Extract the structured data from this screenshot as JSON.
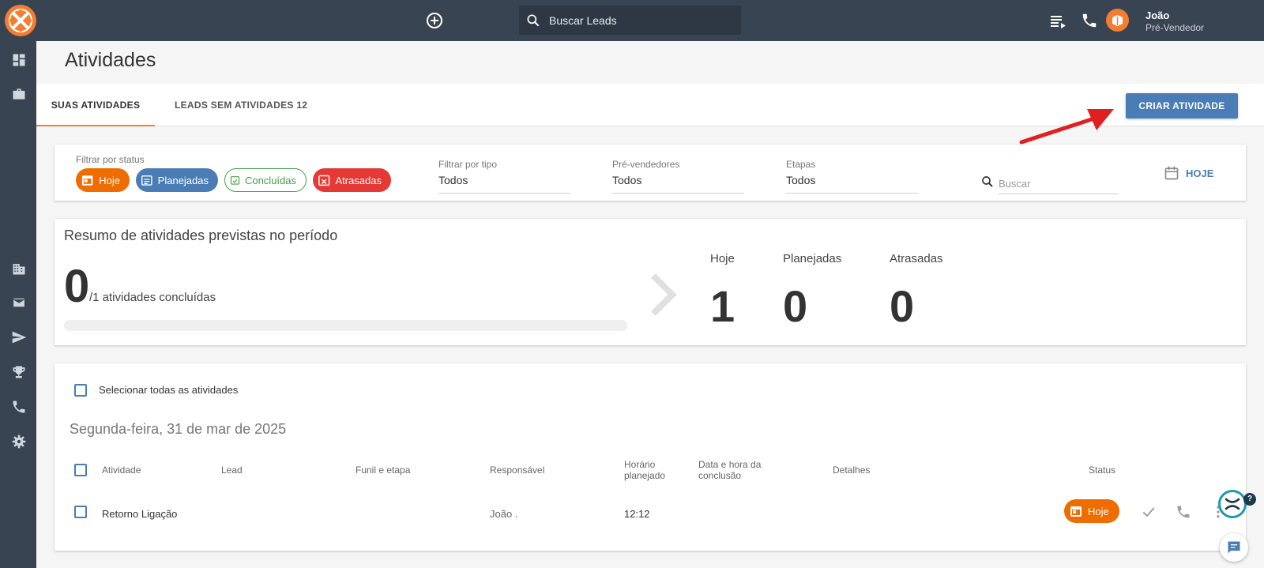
{
  "topbar": {
    "search_placeholder": "Buscar Leads",
    "user_name": "João",
    "user_role": "Pré-Vendedor"
  },
  "page": {
    "title": "Atividades"
  },
  "tabs": [
    {
      "label": "SUAS ATIVIDADES",
      "active": true
    },
    {
      "label": "LEADS SEM ATIVIDADES 12",
      "active": false
    }
  ],
  "actions": {
    "create_label": "CRIAR ATIVIDADE"
  },
  "filters": {
    "status_label": "Filtrar por status",
    "status_chips": [
      "Hoje",
      "Planejadas",
      "Concluídas",
      "Atrasadas"
    ],
    "type_label": "Filtrar por tipo",
    "type_value": "Todos",
    "presales_label": "Pré-vendedores",
    "presales_value": "Todos",
    "stages_label": "Etapas",
    "stages_value": "Todos",
    "search_placeholder": "Buscar",
    "date_button": "HOJE"
  },
  "summary": {
    "title": "Resumo de atividades previstas no período",
    "completed": "0",
    "completed_suffix": "/1 atividades concluídas",
    "progress": 0,
    "stats": [
      {
        "label": "Hoje",
        "value": "1"
      },
      {
        "label": "Planejadas",
        "value": "0"
      },
      {
        "label": "Atrasadas",
        "value": "0"
      }
    ]
  },
  "list": {
    "select_all_label": "Selecionar todas as atividades",
    "date_heading": "Segunda-feira, 31 de mar de 2025",
    "columns": {
      "activity": "Atividade",
      "lead": "Lead",
      "funnel": "Funil e etapa",
      "owner": "Responsável",
      "planned_time": "Horário planejado",
      "completed_at": "Data e hora da conclusão",
      "details": "Detalhes",
      "status": "Status"
    },
    "rows": [
      {
        "activity": "Retorno Ligação",
        "lead": "",
        "funnel": "",
        "owner": "João .",
        "planned_time": "12:12",
        "completed_at": "",
        "details": "",
        "status": "Hoje"
      }
    ]
  },
  "colors": {
    "topbar": "#384452",
    "accent_orange": "#f47d30",
    "primary_blue": "#4a7cb5",
    "today_orange": "#ef6c00",
    "done_green": "#43a047",
    "late_red": "#e53935",
    "annotation_arrow": "#e02020"
  },
  "icons": {
    "sidebar": [
      "dashboard-icon",
      "briefcase-icon",
      "building-icon",
      "mail-icon",
      "send-icon",
      "trophy-icon",
      "phone-icon",
      "settings-icon"
    ]
  }
}
